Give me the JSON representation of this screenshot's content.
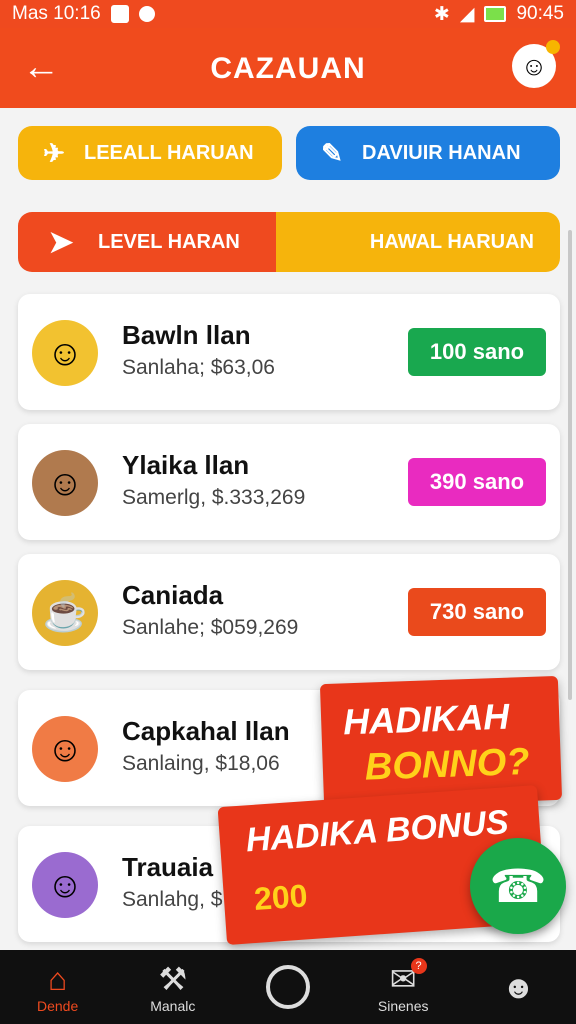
{
  "status_bar": {
    "left_text": "Mas 10:16",
    "time": "90:45"
  },
  "app_bar": {
    "back_icon": "arrow-left-icon",
    "title": "CAZAUAN",
    "mascot_icon": "mascot-icon"
  },
  "filters": {
    "left_label": "LEEALL HARUAN",
    "right_label": "DAVIUIR HANAN"
  },
  "toggle": {
    "left_label": "LEVEL HARAN",
    "right_label": "HAWAL HARUAN"
  },
  "cards": [
    {
      "name": "Bawln llan",
      "sub": "Sanlaha; $63,06",
      "badge": "100 sano",
      "badge_color": "#19a84f",
      "avatar_color": "#f2c230"
    },
    {
      "name": "Ylaika llan",
      "sub": "Samerlg, $.333,269",
      "badge": "390 sano",
      "badge_color": "#e92bc0",
      "avatar_color": "#b07a4e"
    },
    {
      "name": "Caniada",
      "sub": "Sanlahe; $059,269",
      "badge": "730 sano",
      "badge_color": "#ea4a1c",
      "avatar_color": "#e5b331"
    },
    {
      "name": "Capkahal llan",
      "sub": "Sanlaing, $18,06",
      "badge": "",
      "badge_color": "#ea4a1c",
      "avatar_color": "#f07b45"
    },
    {
      "name": "Trauaia",
      "sub": "Sanlahg, $",
      "badge": "",
      "badge_color": "#ea4a1c",
      "avatar_color": "#9a6bd0"
    }
  ],
  "promo": {
    "line1": "HADIKAH",
    "line2": "BONNO?",
    "line3": "HADIKA BONUS",
    "coin_text": "200"
  },
  "fab_icon": "phone-icon",
  "bottom_nav": [
    {
      "label": "Dende",
      "icon": "home-icon",
      "active": true
    },
    {
      "label": "Manalc",
      "icon": "tools-icon",
      "active": false
    },
    {
      "label": "",
      "icon": "circle-home-icon",
      "active": false
    },
    {
      "label": "Sinenes",
      "icon": "inbox-icon",
      "active": false,
      "badge": "?"
    },
    {
      "label": "",
      "icon": "profile-icon",
      "active": false
    }
  ]
}
